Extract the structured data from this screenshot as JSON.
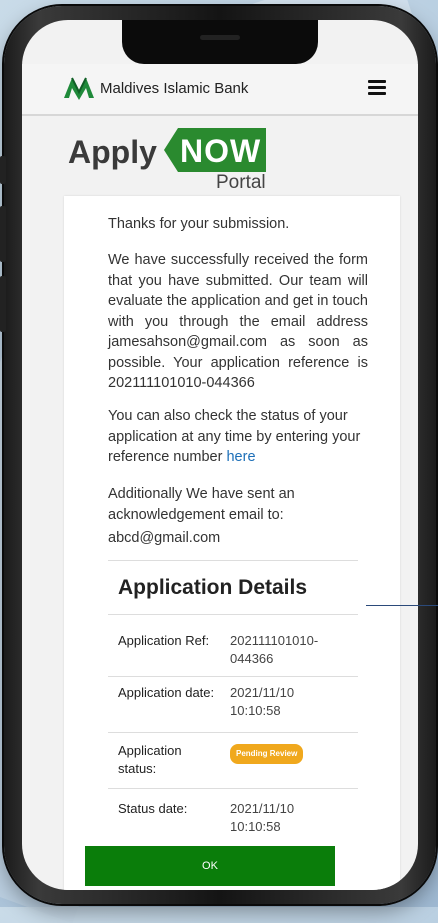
{
  "header": {
    "brand": "Maldives Islamic Bank",
    "logo_icon": "mib-logo-icon",
    "menu_icon": "hamburger-menu-icon"
  },
  "hero": {
    "apply": "Apply",
    "now": "NOW",
    "portal": "Portal"
  },
  "message": {
    "thanks": "Thanks for your submission.",
    "received": "We have successfully received the form that you have submitted. Our team will evaluate the application and get in touch with you through the email address jamesahson@gmail.com as soon as possible. Your application reference is 202111101010-044366",
    "status_check_prefix": "You can also check the status of your application at any time by entering your reference number ",
    "status_check_link": "here",
    "ack_text": "Additionally We have sent an acknowledgement email to:",
    "ack_email": "abcd@gmail.com"
  },
  "details": {
    "title": "Application Details",
    "rows": [
      {
        "label": "Application Ref:",
        "value": "202111101010-044366"
      },
      {
        "label": "Application date:",
        "value": "2021/11/10 10:10:58"
      },
      {
        "label": "Application status:",
        "value": "Pending Review"
      },
      {
        "label": "Status date:",
        "value": "2021/11/10 10:10:58"
      }
    ]
  },
  "actions": {
    "ok_label": "OK"
  },
  "colors": {
    "brand_green": "#2a8a2f",
    "ok_button": "#0a7d0a",
    "badge_pending": "#f0a81d",
    "link": "#1d6fb8"
  }
}
